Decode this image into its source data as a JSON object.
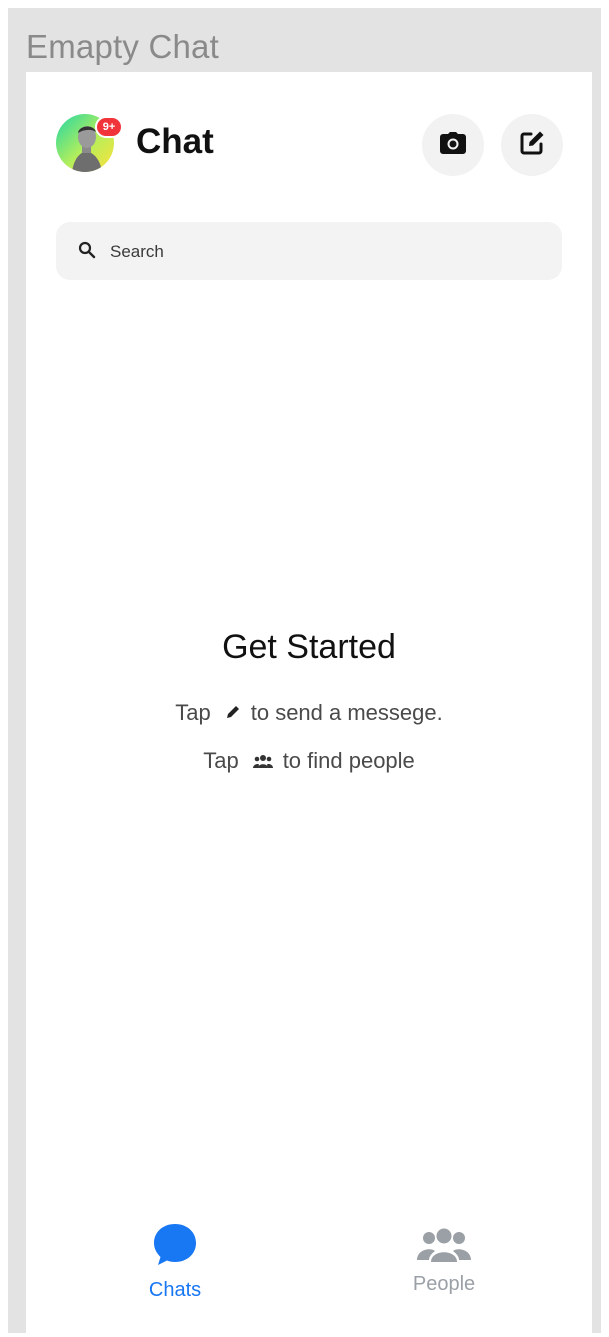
{
  "frame": {
    "title": "Emapty Chat"
  },
  "header": {
    "title": "Chat",
    "badge": "9+",
    "camera_icon": "camera-icon",
    "compose_icon": "edit-icon"
  },
  "search": {
    "placeholder": "Search",
    "icon": "search-icon"
  },
  "empty_state": {
    "title": "Get Started",
    "line1": {
      "prefix": "Tap",
      "icon": "pencil-icon",
      "suffix": "to send a messege."
    },
    "line2": {
      "prefix": "Tap",
      "icon": "people-icon",
      "suffix": "to find people"
    }
  },
  "tabs": [
    {
      "label": "Chats",
      "icon": "chat-bubble-icon",
      "active": true
    },
    {
      "label": "People",
      "icon": "people-icon",
      "active": false
    }
  ],
  "colors": {
    "accent": "#1877f2",
    "inactive": "#9aa0a6",
    "badge": "#f0343a"
  }
}
